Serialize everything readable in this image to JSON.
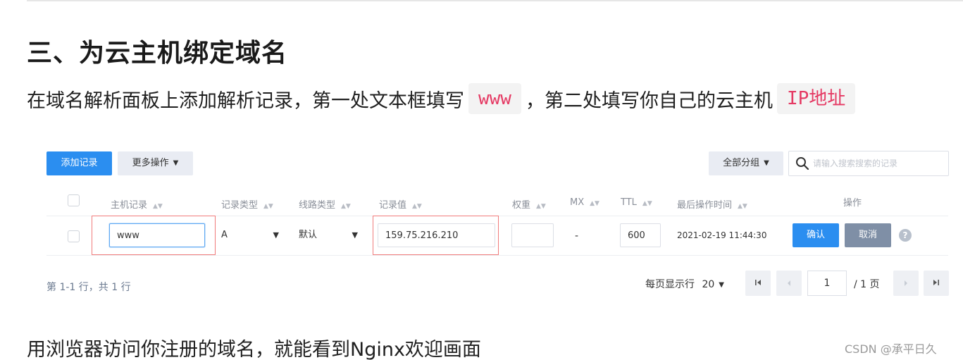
{
  "heading": "三、为云主机绑定域名",
  "instruction": {
    "part1": "在域名解析面板上添加解析记录，第一处文本框填写",
    "code1": "www",
    "part2": "，第二处填写你自己的云主机",
    "code2": "IP地址"
  },
  "toolbar": {
    "add_record": "添加记录",
    "more_actions": "更多操作",
    "all_groups": "全部分组",
    "search_placeholder": "请输入搜索搜索的记录"
  },
  "table": {
    "headers": [
      "主机记录",
      "记录类型",
      "线路类型",
      "记录值",
      "权重",
      "MX",
      "TTL",
      "最后操作时间",
      "操作"
    ],
    "row": {
      "host": "www",
      "type": "A",
      "line": "默认",
      "value": "159.75.216.210",
      "weight": "",
      "mx": "-",
      "ttl": "600",
      "last_modified": "2021-02-19 11:44:30",
      "confirm": "确认",
      "cancel": "取消"
    }
  },
  "footer": {
    "summary": "第 1-1 行，共 1 行",
    "per_page_label": "每页显示行",
    "per_page_value": "20",
    "current_page": "1",
    "total_pages": "/ 1 页"
  },
  "bottom_text": "用浏览器访问你注册的域名，就能看到Nginx欢迎画面",
  "watermark": "CSDN @承平日久",
  "colors": {
    "primary": "#2b8ef0",
    "code_text": "#e53963",
    "highlight_border": "#f07b7b"
  }
}
